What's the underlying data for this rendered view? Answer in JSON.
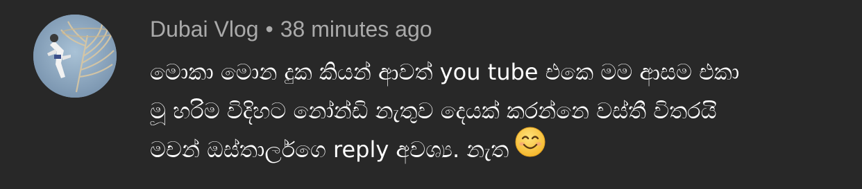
{
  "comment": {
    "author": "Dubai Vlog",
    "separator": "•",
    "time": "38 minutes ago",
    "lines": [
      "මොකා මොන දුක කියන් ආවත් you tube එකෙ මම ආසම එකා",
      "මූ හරිම විදිහට නෝන්ඩි නැතුව දෙයක් කරන්නෙ වස්තී විතරයි",
      "මචන් ඔස්තාර්ලගෙ reply අවශ්‍ය. නැත"
    ],
    "emoji_icon": "smiling-face-emoji",
    "avatar_icon": "skydiver-over-palm-island-avatar"
  }
}
